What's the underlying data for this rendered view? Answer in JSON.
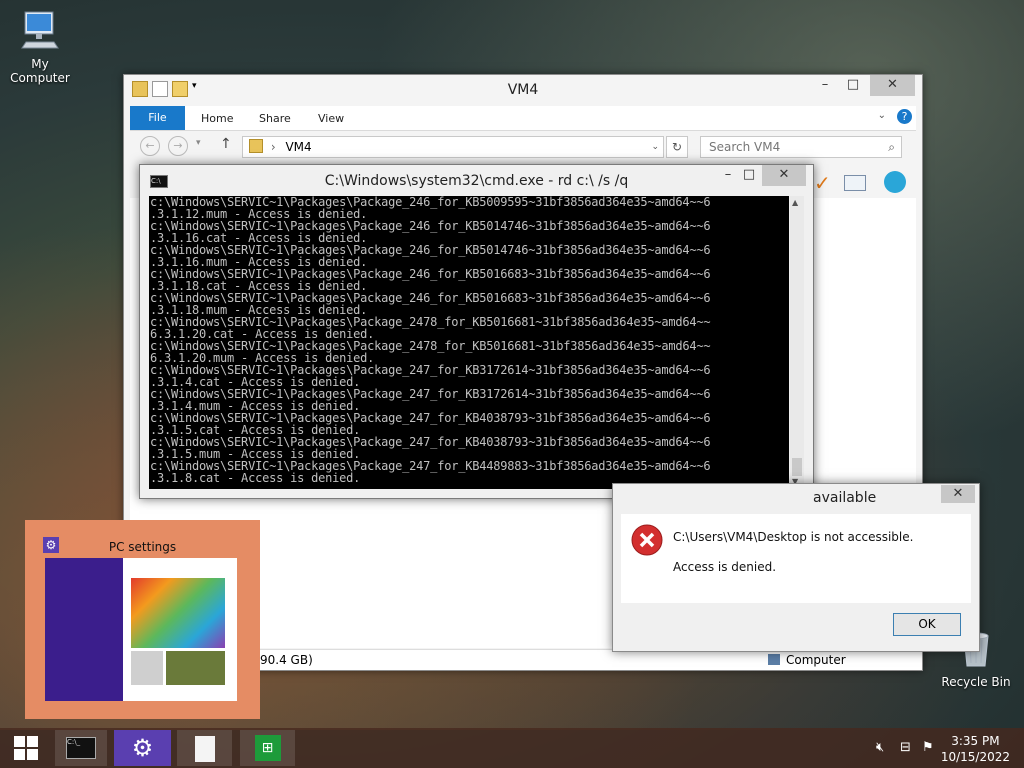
{
  "desktop": {
    "icons": [
      {
        "label": "My Computer"
      },
      {
        "label": "Recycle Bin"
      }
    ]
  },
  "explorer": {
    "title": "VM4",
    "ribbon_tabs": [
      "File",
      "Home",
      "Share",
      "View"
    ],
    "address": "VM4",
    "search_placeholder": "Search VM4",
    "status_size": "90.4 GB)",
    "status_location": "Computer"
  },
  "cmd": {
    "title": "C:\\Windows\\system32\\cmd.exe - rd  c:\\ /s /q",
    "lines": [
      "c:\\Windows\\SERVIC~1\\Packages\\Package_246_for_KB5009595~31bf3856ad364e35~amd64~~6",
      ".3.1.12.mum - Access is denied.",
      "c:\\Windows\\SERVIC~1\\Packages\\Package_246_for_KB5014746~31bf3856ad364e35~amd64~~6",
      ".3.1.16.cat - Access is denied.",
      "c:\\Windows\\SERVIC~1\\Packages\\Package_246_for_KB5014746~31bf3856ad364e35~amd64~~6",
      ".3.1.16.mum - Access is denied.",
      "c:\\Windows\\SERVIC~1\\Packages\\Package_246_for_KB5016683~31bf3856ad364e35~amd64~~6",
      ".3.1.18.cat - Access is denied.",
      "c:\\Windows\\SERVIC~1\\Packages\\Package_246_for_KB5016683~31bf3856ad364e35~amd64~~6",
      ".3.1.18.mum - Access is denied.",
      "c:\\Windows\\SERVIC~1\\Packages\\Package_2478_for_KB5016681~31bf3856ad364e35~amd64~~",
      "6.3.1.20.cat - Access is denied.",
      "c:\\Windows\\SERVIC~1\\Packages\\Package_2478_for_KB5016681~31bf3856ad364e35~amd64~~",
      "6.3.1.20.mum - Access is denied.",
      "c:\\Windows\\SERVIC~1\\Packages\\Package_247_for_KB3172614~31bf3856ad364e35~amd64~~6",
      ".3.1.4.cat - Access is denied.",
      "c:\\Windows\\SERVIC~1\\Packages\\Package_247_for_KB3172614~31bf3856ad364e35~amd64~~6",
      ".3.1.4.mum - Access is denied.",
      "c:\\Windows\\SERVIC~1\\Packages\\Package_247_for_KB4038793~31bf3856ad364e35~amd64~~6",
      ".3.1.5.cat - Access is denied.",
      "c:\\Windows\\SERVIC~1\\Packages\\Package_247_for_KB4038793~31bf3856ad364e35~amd64~~6",
      ".3.1.5.mum - Access is denied.",
      "c:\\Windows\\SERVIC~1\\Packages\\Package_247_for_KB4489883~31bf3856ad364e35~amd64~~6",
      ".3.1.8.cat - Access is denied."
    ]
  },
  "pc_settings": {
    "title": "PC settings"
  },
  "dialog": {
    "title_fragment": "available",
    "message": "C:\\Users\\VM4\\Desktop is not accessible.",
    "detail": "Access is denied.",
    "ok_label": "OK"
  },
  "clock": {
    "time": "3:35 PM",
    "date": "10/15/2022"
  },
  "colors": {
    "file_tab": "#1979ca",
    "thumb_bg": "#e58c64",
    "error_red": "#d32f2f"
  }
}
